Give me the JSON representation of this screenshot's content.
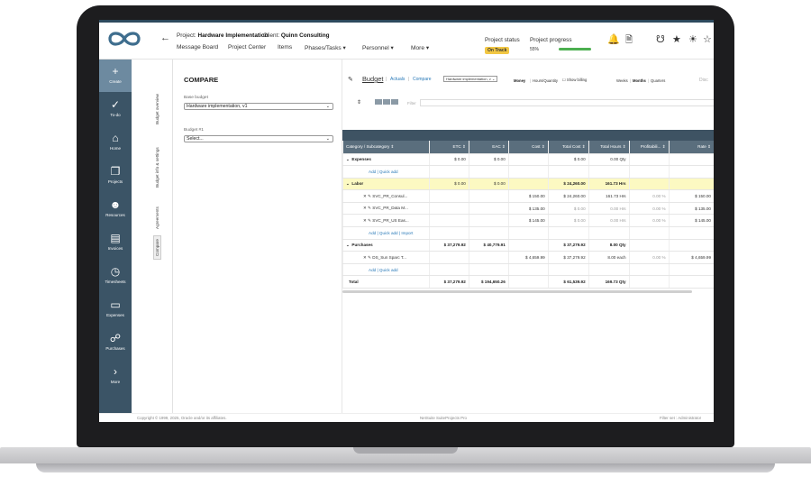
{
  "header": {
    "back_icon": "arrow-left-icon",
    "project_label": "Project:",
    "project_name": "Hardware Implementation",
    "client_label": "Client:",
    "client_name": "Quinn Consulting",
    "nav": [
      "Message Board",
      "Project Center",
      "Items",
      "Phases/Tasks",
      "Personnel",
      "More"
    ],
    "project_status_label": "Project status",
    "project_status_value": "On Track",
    "project_progress_label": "Project progress",
    "project_progress_value": "55%",
    "progress_fraction": 0.55,
    "icons": [
      "bell-icon",
      "document-icon",
      "megaphone-icon",
      "award-icon",
      "lightbulb-icon",
      "star-icon"
    ]
  },
  "sidebar": {
    "items": [
      {
        "label": "Create",
        "icon": "plus-icon"
      },
      {
        "label": "To-do",
        "icon": "check-circle-icon"
      },
      {
        "label": "Home",
        "icon": "home-icon"
      },
      {
        "label": "Projects",
        "icon": "projects-icon"
      },
      {
        "label": "Resources",
        "icon": "people-icon"
      },
      {
        "label": "Invoices",
        "icon": "invoice-icon"
      },
      {
        "label": "Timesheets",
        "icon": "clock-icon"
      },
      {
        "label": "Expenses",
        "icon": "card-icon"
      },
      {
        "label": "Purchases",
        "icon": "cart-icon"
      },
      {
        "label": "More",
        "icon": "chevron-right-icon"
      }
    ]
  },
  "vtabs": [
    "Budget overview",
    "Budget info & settings",
    "Agreements",
    "Compare"
  ],
  "compare": {
    "title": "COMPARE",
    "base_label": "Base budget",
    "base_value": "Hardware implementation, v1",
    "budget1_label": "Budget #1",
    "budget1_value": "Select..."
  },
  "budget": {
    "tab_budget": "Budget",
    "tab_actuals": "Actuals",
    "tab_compare": "Compare",
    "dropdown": "Hardware implementation, v",
    "money_label": "Money",
    "hours_qty_label": "Hours/Quantity",
    "show_billing_label": "Show billing",
    "weeks_label": "Weeks",
    "months_label": "Months",
    "quarters_label": "Quarters",
    "disc_label": "Disc",
    "filter_label": "Filter",
    "columns": [
      "Category / Subcategory",
      "ETC",
      "EAC",
      "Cost",
      "Total Cost",
      "Total Hours",
      "Profitabili...",
      "Rate"
    ],
    "rows": [
      {
        "type": "group",
        "cells": [
          "Expenses",
          "$ 0.00",
          "$ 0.00",
          "",
          "$ 0.00",
          "0.00 Qty",
          "",
          ""
        ]
      },
      {
        "type": "add",
        "cells": [
          "Add | Quick add"
        ]
      },
      {
        "type": "labor",
        "cells": [
          "Labor",
          "$ 0.00",
          "$ 0.00",
          "",
          "$ 24,260.00",
          "161.73 Hrs",
          "",
          ""
        ]
      },
      {
        "type": "item",
        "cells": [
          "SVC_PR_Consul...",
          "",
          "",
          "$ 150.00",
          "$ 24,260.00",
          "161.73 Hrs",
          "0.00 %",
          "$ 150.00"
        ]
      },
      {
        "type": "item",
        "cells": [
          "SVC_PR_Data M...",
          "",
          "",
          "$ 135.00",
          "$ 0.00",
          "0.00 Hrs",
          "0.00 %",
          "$ 135.00"
        ]
      },
      {
        "type": "item",
        "cells": [
          "SVC_PR_US Eas...",
          "",
          "",
          "$ 145.00",
          "$ 0.00",
          "0.00 Hrs",
          "0.00 %",
          "$ 145.00"
        ]
      },
      {
        "type": "add",
        "cells": [
          "Add | Quick add | Import"
        ]
      },
      {
        "type": "group",
        "cells": [
          "Purchases",
          "$ 37,279.92",
          "$ 40,779.91",
          "",
          "$ 37,279.92",
          "8.00 Qty",
          "",
          ""
        ]
      },
      {
        "type": "item",
        "cells": [
          "DS_Sun Sparc T...",
          "",
          "",
          "$ 4,659.99",
          "$ 37,279.92",
          "8.00 each",
          "0.00 %",
          "$ 4,659.99"
        ]
      },
      {
        "type": "add",
        "cells": [
          "Add | Quick add"
        ]
      },
      {
        "type": "total",
        "cells": [
          "Total",
          "$ 37,279.92",
          "$ 194,650.26",
          "",
          "$ 61,539.92",
          "169.73 Qty",
          "",
          ""
        ]
      }
    ]
  },
  "footer": {
    "copyright": "Copyright © 1999, 2025, Oracle and/or its affiliates.",
    "product": "NetSuite SuiteProjects Pro",
    "user": "Filter set : Administrator"
  },
  "colors": {
    "sidebar": "#3b5466",
    "accent": "#2d4a5e",
    "labor_row": "#fcf9c2",
    "status": "#f2c744",
    "progress": "#4caf50"
  }
}
